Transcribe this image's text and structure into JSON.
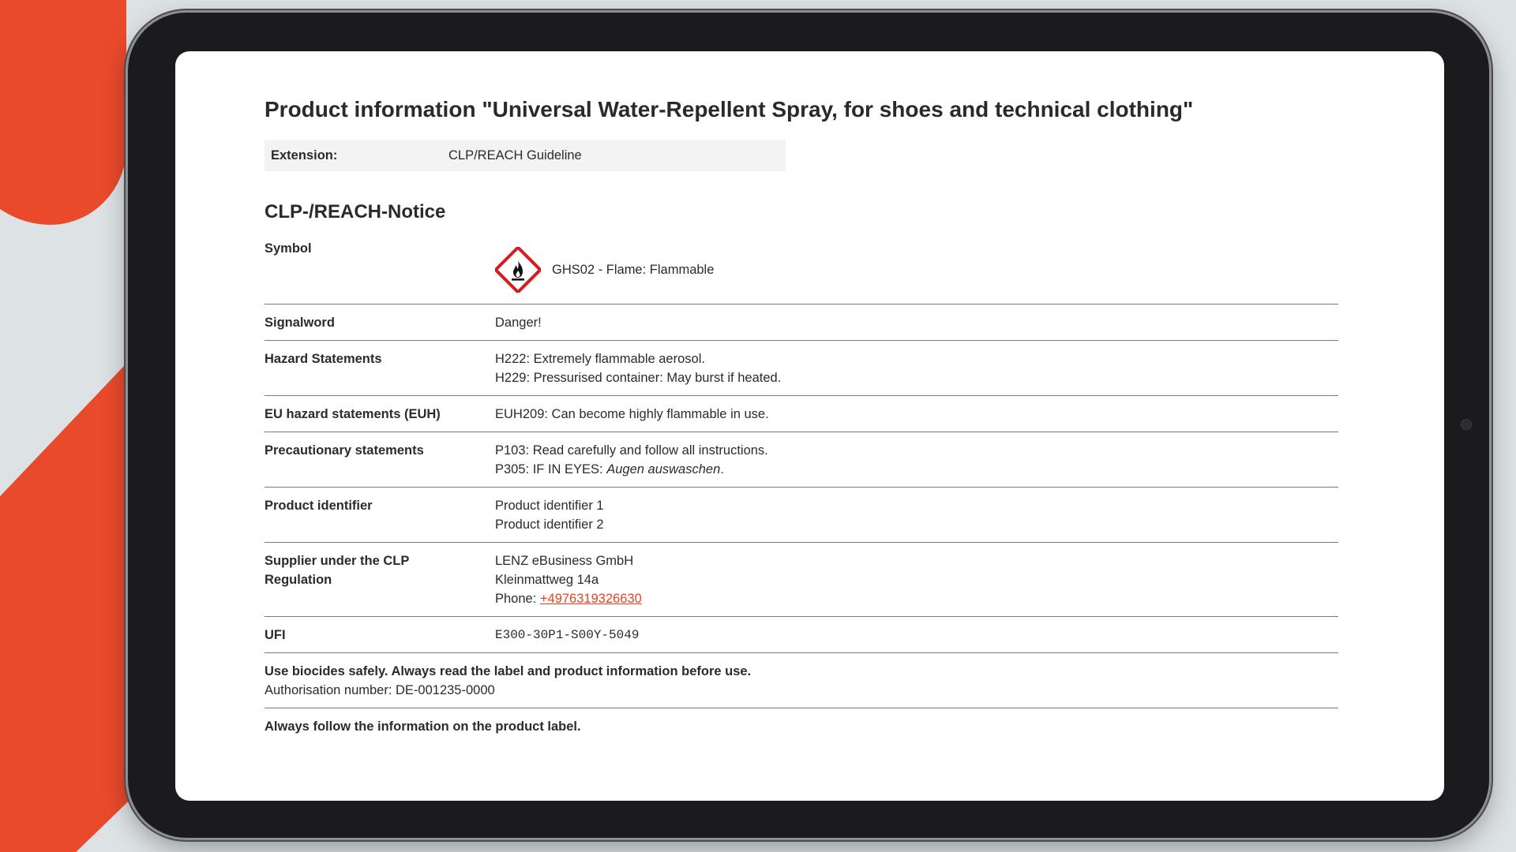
{
  "page": {
    "title": "Product information \"Universal Water-Repellent Spray, for shoes and technical clothing\""
  },
  "extension": {
    "label": "Extension:",
    "value": "CLP/REACH Guideline"
  },
  "notice": {
    "heading": "CLP-/REACH-Notice",
    "symbol": {
      "label": "Symbol",
      "icon": "ghs02-flame-icon",
      "text": "GHS02 - Flame: Flammable"
    },
    "signalword": {
      "label": "Signalword",
      "value": "Danger!"
    },
    "hazard": {
      "label": "Hazard Statements",
      "lines": [
        "H222: Extremely flammable aerosol.",
        "H229: Pressurised container: May burst if heated."
      ]
    },
    "euh": {
      "label": "EU hazard statements (EUH)",
      "value": "EUH209: Can become highly flammable in use."
    },
    "precautionary": {
      "label": "Precautionary statements",
      "line1": "P103: Read carefully and follow all instructions.",
      "line2_prefix": "P305: IF IN EYES: ",
      "line2_italic": "Augen auswaschen",
      "line2_suffix": "."
    },
    "product_identifier": {
      "label": "Product identifier",
      "lines": [
        "Product identifier 1",
        "Product identifier 2"
      ]
    },
    "supplier": {
      "label": "Supplier under the CLP Regulation",
      "name": "LENZ eBusiness GmbH",
      "street": "Kleinmattweg 14a",
      "phone_label": "Phone: ",
      "phone": "+4976319326630"
    },
    "ufi": {
      "label": "UFI",
      "value": "E300-30P1-S00Y-5049"
    },
    "biocide": {
      "warning": "Use biocides safely. Always read the label and product information before use.",
      "authorisation": "Authorisation number: DE-001235-0000"
    },
    "footer": "Always follow the information on the product label."
  },
  "colors": {
    "accent": "#ea4a2c",
    "link": "#e8431f",
    "ghs_red": "#d71920",
    "device": "#1b1b1e"
  }
}
